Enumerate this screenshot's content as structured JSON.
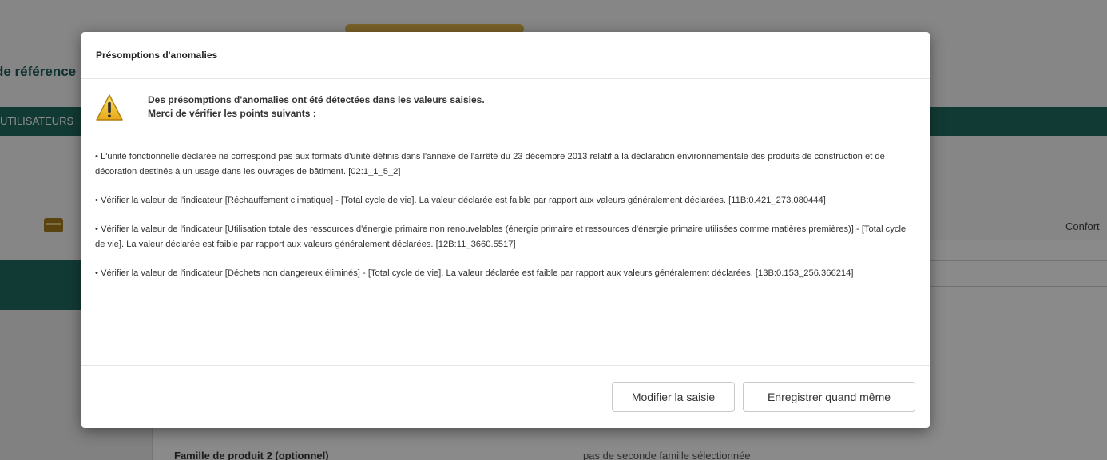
{
  "background": {
    "title": "de référence",
    "nav_item": "UTILISATEURS",
    "right_label": "Confort",
    "field_label": "Famille de produit 2 (optionnel)",
    "field_value": "pas de seconde famille sélectionnée"
  },
  "modal": {
    "title": "Présomptions d'anomalies",
    "alert_icon": "warning-triangle-icon",
    "alert_line1": "Des présomptions d'anomalies ont été détectées dans les valeurs saisies.",
    "alert_line2": "Merci de vérifier les points suivants :",
    "issues": [
      "• L'unité fonctionnelle déclarée ne correspond pas aux formats d'unité définis dans l'annexe de l'arrêté du 23 décembre 2013 relatif à la déclaration environnementale des produits de construction et de décoration destinés à un usage dans les ouvrages de bâtiment. [02:1_1_5_2]",
      "• Vérifier la valeur de l'indicateur [Réchauffement climatique] - [Total cycle de vie]. La valeur déclarée est faible par rapport aux valeurs généralement déclarées. [11B:0.421_273.080444]",
      "• Vérifier la valeur de l'indicateur [Utilisation totale des ressources d'énergie primaire non renouvelables (énergie primaire et ressources d'énergie primaire utilisées comme matières premières)] - [Total cycle de vie]. La valeur déclarée est faible par rapport aux valeurs généralement déclarées. [12B:11_3660.5517]",
      "• Vérifier la valeur de l'indicateur [Déchets non dangereux éliminés] - [Total cycle de vie]. La valeur déclarée est faible par rapport aux valeurs généralement déclarées. [13B:0.153_256.366214]"
    ],
    "buttons": {
      "modify": "Modifier la saisie",
      "save_anyway": "Enregistrer quand même"
    }
  },
  "colors": {
    "brand_green": "#216a60",
    "warning_yellow": "#f2c230"
  }
}
